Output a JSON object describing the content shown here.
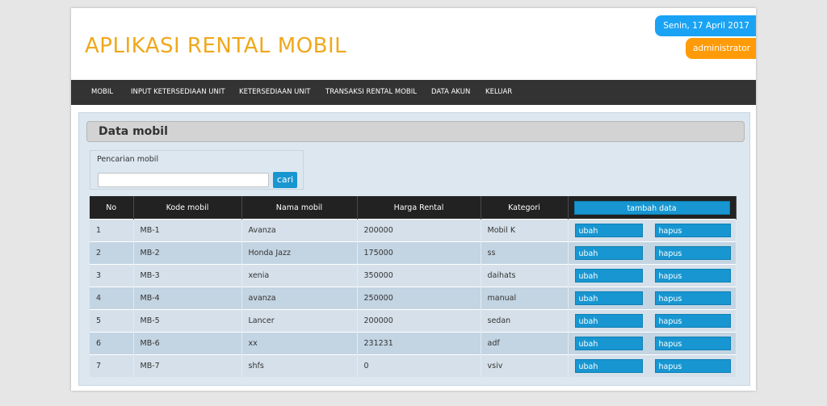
{
  "header": {
    "app_title": "APLIKASI RENTAL MOBIL",
    "date": "Senin, 17 April 2017",
    "user": "administrator"
  },
  "nav": {
    "items": [
      {
        "label": "MOBIL"
      },
      {
        "label": "INPUT KETERSEDIAAN UNIT"
      },
      {
        "label": "KETERSEDIAAN UNIT"
      },
      {
        "label": "TRANSAKSI RENTAL MOBIL"
      },
      {
        "label": "DATA AKUN"
      },
      {
        "label": "KELUAR"
      }
    ]
  },
  "main": {
    "section_title": "Data mobil",
    "search": {
      "label": "Pencarian mobil",
      "value": "",
      "button": "cari"
    },
    "table": {
      "columns": [
        "No",
        "Kode mobil",
        "Nama mobil",
        "Harga Rental",
        "Kategori"
      ],
      "add_button": "tambah data",
      "edit_label": "ubah",
      "delete_label": "hapus",
      "rows": [
        [
          "1",
          "MB-1",
          "Avanza",
          "200000",
          "Mobil K"
        ],
        [
          "2",
          "MB-2",
          "Honda Jazz",
          "175000",
          "ss"
        ],
        [
          "3",
          "MB-3",
          "xenia",
          "350000",
          "daihats"
        ],
        [
          "4",
          "MB-4",
          "avanza",
          "250000",
          "manual"
        ],
        [
          "5",
          "MB-5",
          "Lancer",
          "200000",
          "sedan"
        ],
        [
          "6",
          "MB-6",
          "xx",
          "231231",
          "adf"
        ],
        [
          "7",
          "MB-7",
          "shfs",
          "0",
          "vsiv"
        ]
      ]
    }
  },
  "colors": {
    "title": "#f0a81c",
    "navbar": "#333333",
    "primary_button": "#1796d1",
    "date_badge": "#1aa3f5",
    "user_badge": "#ff9b08"
  }
}
